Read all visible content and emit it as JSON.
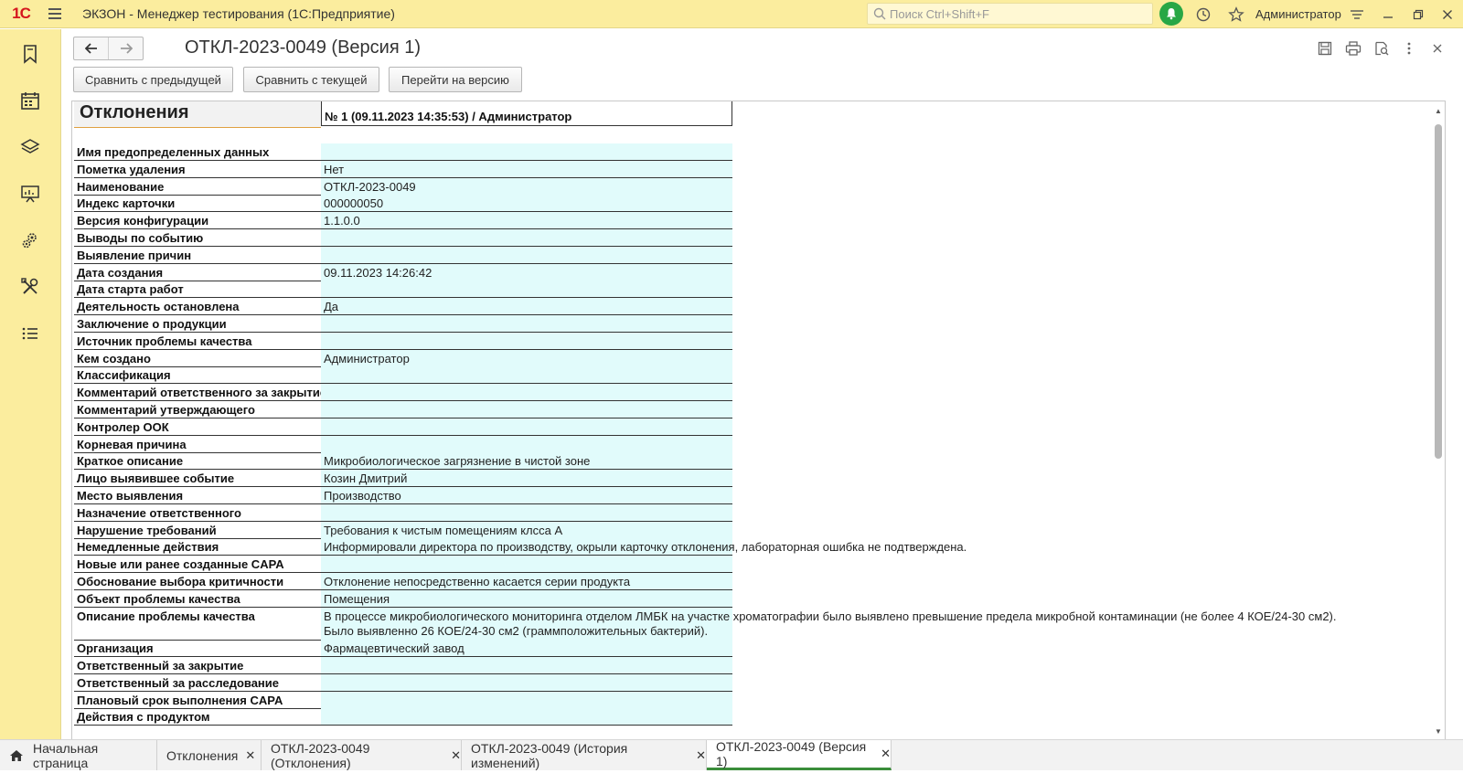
{
  "app": {
    "logo": "1С",
    "title": "ЭКЗОН  - Менеджер тестирования (1С:Предприятие)",
    "search_placeholder": "Поиск Ctrl+Shift+F",
    "user": "Администратор"
  },
  "sidebar": {
    "items": [
      "bookmarks-icon",
      "calendar-icon",
      "layers-icon",
      "presentation-icon",
      "gears-icon",
      "tools-icon",
      "list-icon"
    ]
  },
  "form": {
    "title": "ОТКЛ-2023-0049 (Версия 1)",
    "buttons": {
      "compare_prev": "Сравнить с предыдущей",
      "compare_current": "Сравнить с текущей",
      "goto_version": "Перейти на версию"
    }
  },
  "report": {
    "header_left": "Отклонения",
    "header_right": "№ 1 (09.11.2023 14:35:53) / Администратор",
    "rows": [
      {
        "label": "Имя предопределенных данных",
        "value": ""
      },
      {
        "label": "Пометка удаления",
        "value": "Нет"
      },
      {
        "label": "Наименование",
        "value": "ОТКЛ-2023-0049"
      },
      {
        "label": "Индекс карточки",
        "value": "000000050"
      },
      {
        "label": "Версия конфигурации",
        "value": "1.1.0.0"
      },
      {
        "label": "Выводы по событию",
        "value": ""
      },
      {
        "label": "Выявление причин",
        "value": ""
      },
      {
        "label": "Дата создания",
        "value": "09.11.2023 14:26:42"
      },
      {
        "label": "Дата старта работ",
        "value": ""
      },
      {
        "label": "Деятельность остановлена",
        "value": "Да"
      },
      {
        "label": "Заключение о продукции",
        "value": ""
      },
      {
        "label": "Источник проблемы качества",
        "value": ""
      },
      {
        "label": "Кем создано",
        "value": "Администратор"
      },
      {
        "label": "Классификация",
        "value": ""
      },
      {
        "label": "Комментарий ответственного за закрытие",
        "value": ""
      },
      {
        "label": "Комментарий утверждающего",
        "value": ""
      },
      {
        "label": "Контролер ООК",
        "value": ""
      },
      {
        "label": "Корневая причина",
        "value": ""
      },
      {
        "label": "Краткое описание",
        "value": "Микробиологическое загрязнение в чистой зоне"
      },
      {
        "label": "Лицо выявившее событие",
        "value": "Козин Дмитрий"
      },
      {
        "label": "Место выявления",
        "value": "Производство"
      },
      {
        "label": "Назначение ответственного",
        "value": ""
      },
      {
        "label": "Нарушение требований",
        "value": "Требования к чистым помещениям клсса А"
      },
      {
        "label": "Немедленные действия",
        "value": "Информировали директора по производству, окрыли карточку отклонения, лабораторная ошибка не подтверждена."
      },
      {
        "label": "Новые или ранее созданные CAPA",
        "value": ""
      },
      {
        "label": "Обоснование выбора критичности",
        "value": "Отклонение непосредственно касается серии продукта"
      },
      {
        "label": "Объект проблемы качества",
        "value": "Помещения"
      },
      {
        "label": "Описание проблемы качества",
        "value": "В процессе микробиологического мониторинга отделом ЛМБК на участке хроматографии было выявлено превышение предела микробной контаминации (не более 4 КОЕ/24-30 см2).",
        "value2": "Было выявленно 26 КОЕ/24-30 см2 (граммположительных бактерий)."
      },
      {
        "label": "Организация",
        "value": "Фармацевтический завод"
      },
      {
        "label": "Ответственный за закрытие",
        "value": ""
      },
      {
        "label": "Ответственный за расследование",
        "value": ""
      },
      {
        "label": "Плановый срок выполнения CAPA",
        "value": ""
      },
      {
        "label": "Действия с продуктом",
        "value": ""
      }
    ]
  },
  "tabs": [
    {
      "label": "Начальная страница",
      "icon": "home-icon"
    },
    {
      "label": "Отклонения"
    },
    {
      "label": "ОТКЛ-2023-0049 (Отклонения)"
    },
    {
      "label": "ОТКЛ-2023-0049 (История изменений)"
    },
    {
      "label": "ОТКЛ-2023-0049 (Версия 1)",
      "active": true
    }
  ],
  "colors": {
    "topbar": "#fbed9e",
    "value_cell": "#e1fbfb",
    "bell": "#28a745",
    "active_tab": "#3b8d3b"
  }
}
